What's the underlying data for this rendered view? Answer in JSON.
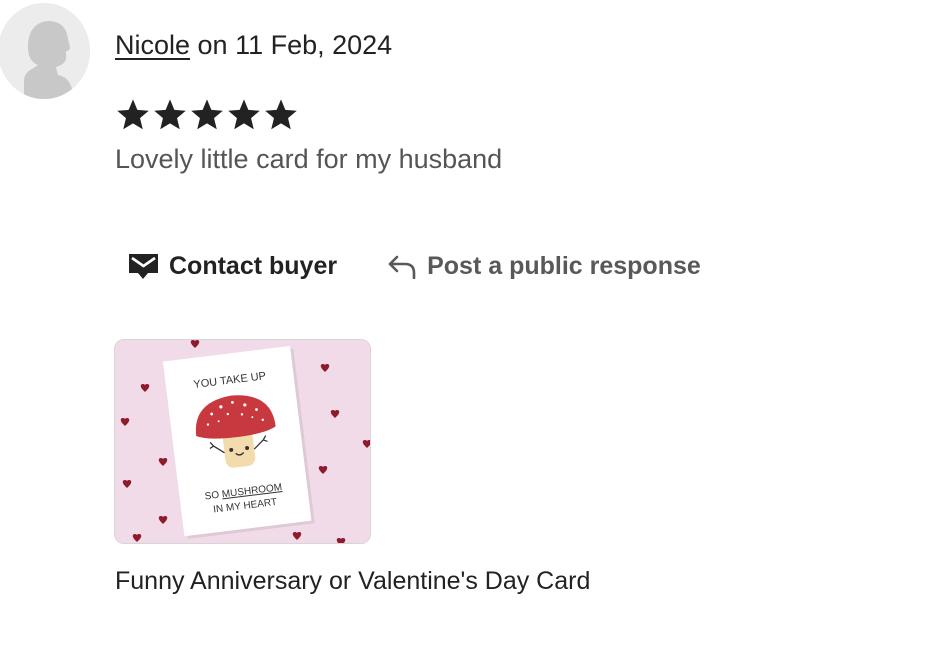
{
  "review": {
    "reviewer_name": "Nicole",
    "date_prefix": " on ",
    "date": "11 Feb, 2024",
    "rating": 5,
    "rating_max": 5,
    "text": "Lovely little card for my husband"
  },
  "actions": {
    "contact_label": "Contact buyer",
    "contact_icon": "envelope-icon",
    "respond_label": "Post a public response",
    "respond_icon": "reply-arrow-icon"
  },
  "product": {
    "title": "Funny Anniversary or Valentine's Day Card",
    "card_text": {
      "line1": "YOU TAKE UP",
      "line2_prefix": "SO ",
      "line2_highlight": "MUSHROOM",
      "line3": "IN MY HEART"
    }
  },
  "colors": {
    "text": "#222222",
    "muted": "#595959",
    "thumb_background": "#f1dbe8",
    "mushroom_cap": "#c8393f",
    "heart": "#8e1b2c"
  }
}
